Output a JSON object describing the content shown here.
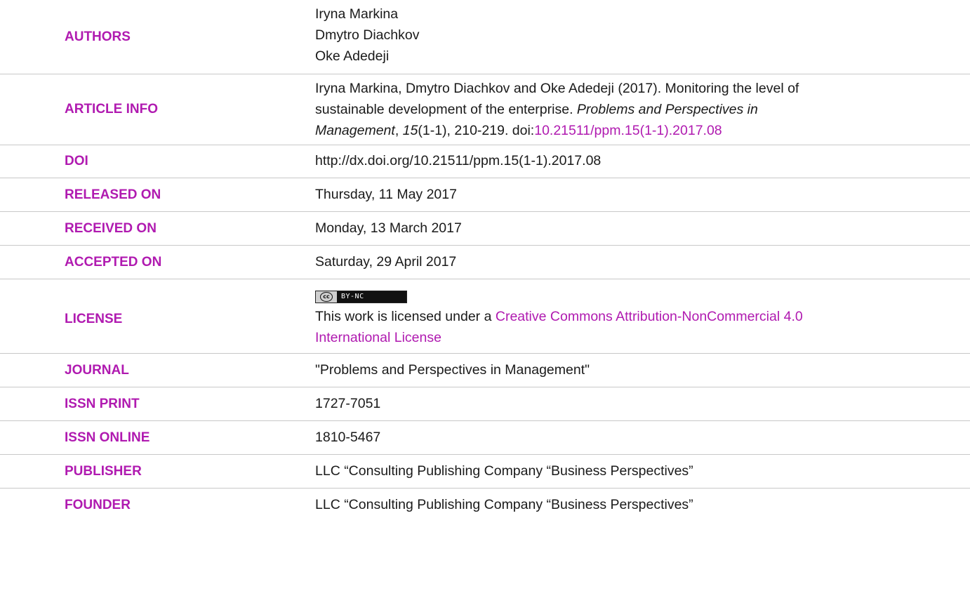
{
  "authors": {
    "label": "AUTHORS",
    "names": [
      "Iryna Markina",
      "Dmytro Diachkov",
      "Oke Adedeji"
    ]
  },
  "article_info": {
    "label": "ARTICLE INFO",
    "line1": "Iryna Markina, Dmytro Diachkov and Oke Adedeji (2017). Monitoring the level of",
    "line2": "sustainable development of the enterprise. ",
    "journal_italic": "Problems and Perspectives in",
    "journal_italic_2": "Management",
    "comma": ", ",
    "volume_italic": "15",
    "citation_rest": "(1-1), 210-219. doi:",
    "doi_link": "10.21511/ppm.15(1-1).2017.08"
  },
  "doi": {
    "label": "DOI",
    "value": "http://dx.doi.org/10.21511/ppm.15(1-1).2017.08"
  },
  "released_on": {
    "label": "RELEASED ON",
    "value": "Thursday, 11 May 2017"
  },
  "received_on": {
    "label": "RECEIVED ON",
    "value": "Monday, 13 March 2017"
  },
  "accepted_on": {
    "label": "ACCEPTED ON",
    "value": "Saturday, 29 April 2017"
  },
  "license": {
    "label": "LICENSE",
    "badge_cc": "cc",
    "badge_terms": "BY-NC",
    "text_prefix": "This work is licensed under a ",
    "link_part1": "Creative Commons Attribution-NonCommercial 4.0",
    "link_part2": "International License"
  },
  "journal": {
    "label": "JOURNAL",
    "value": "\"Problems and Perspectives in Management\""
  },
  "issn_print": {
    "label": "ISSN PRINT",
    "value": "1727-7051"
  },
  "issn_online": {
    "label": "ISSN ONLINE",
    "value": "1810-5467"
  },
  "publisher": {
    "label": "PUBLISHER",
    "value": "LLC “Consulting Publishing Company “Business Perspectives”"
  },
  "founder": {
    "label": "FOUNDER",
    "value": "LLC “Consulting Publishing Company “Business Perspectives”"
  },
  "colors": {
    "label_accent": "#b01ab0",
    "text": "#1a1a1a",
    "divider": "#c8c8c8"
  }
}
